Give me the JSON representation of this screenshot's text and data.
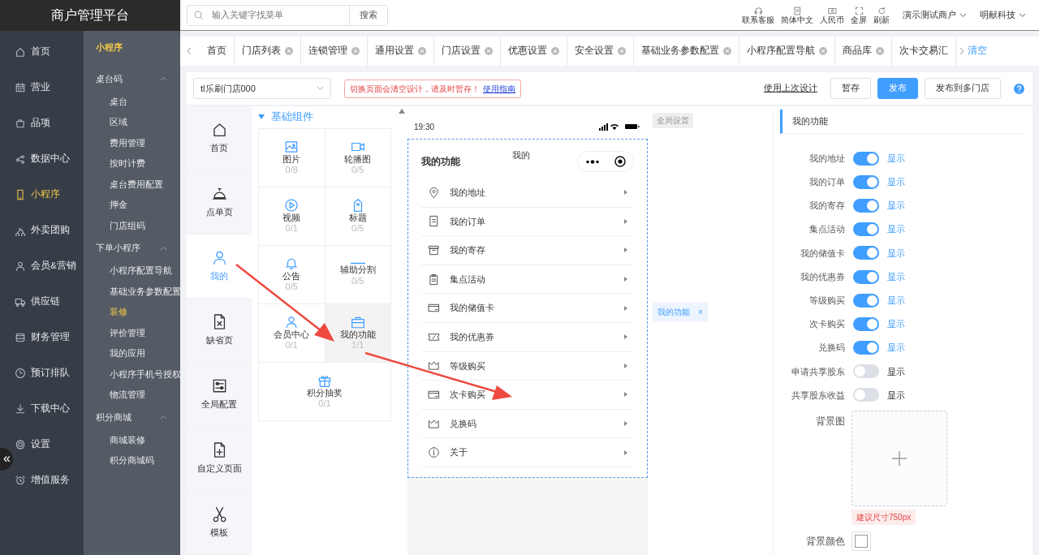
{
  "brand": {
    "title": "商户管理平台"
  },
  "search": {
    "placeholder": "输入关键字找菜单",
    "button": "搜索"
  },
  "header_tools": [
    {
      "label": "联系客服",
      "kind": "headset"
    },
    {
      "label": "简体中文",
      "kind": "doc"
    },
    {
      "label": "人民币",
      "kind": "money"
    },
    {
      "label": "全屏",
      "kind": "fullscreen"
    },
    {
      "label": "刷新",
      "kind": "refresh"
    }
  ],
  "accounts": [
    "演示测试商户",
    "明献科技"
  ],
  "nav": [
    {
      "label": "首页",
      "kind": "home",
      "selected": false
    },
    {
      "label": "营业",
      "kind": "calendar",
      "selected": false
    },
    {
      "label": "品项",
      "kind": "bag",
      "selected": false
    },
    {
      "label": "数据中心",
      "kind": "share",
      "selected": false
    },
    {
      "label": "小程序",
      "kind": "mobile",
      "selected": true
    },
    {
      "label": "外卖团购",
      "kind": "bike",
      "selected": false
    },
    {
      "label": "会员&营销",
      "kind": "user",
      "selected": false
    },
    {
      "label": "供应链",
      "kind": "truck",
      "selected": false
    },
    {
      "label": "财务管理",
      "kind": "database",
      "selected": false
    },
    {
      "label": "预订排队",
      "kind": "clock",
      "selected": false
    },
    {
      "label": "下载中心",
      "kind": "download",
      "selected": false
    },
    {
      "label": "设置",
      "kind": "gear",
      "selected": false
    },
    {
      "label": "增值服务",
      "kind": "alarm",
      "selected": false
    }
  ],
  "collapse_button": "«",
  "subnav": {
    "title": "小程序",
    "groups": [
      {
        "label": "桌台码",
        "expanded": true,
        "items": [
          {
            "label": "桌台",
            "selected": false
          },
          {
            "label": "区域",
            "selected": false
          },
          {
            "label": "费用管理",
            "selected": false
          },
          {
            "label": "按时计费",
            "selected": false
          },
          {
            "label": "桌台费用配置",
            "selected": false
          },
          {
            "label": "押金",
            "selected": false
          },
          {
            "label": "门店组码",
            "selected": false
          }
        ]
      },
      {
        "label": "下单小程序",
        "expanded": true,
        "items": [
          {
            "label": "小程序配置导航",
            "selected": false
          },
          {
            "label": "基础业务参数配置",
            "selected": false
          },
          {
            "label": "装修",
            "selected": true
          },
          {
            "label": "评价管理",
            "selected": false
          },
          {
            "label": "我的应用",
            "selected": false
          },
          {
            "label": "小程序手机号授权",
            "selected": false
          },
          {
            "label": "物流管理",
            "selected": false
          }
        ]
      },
      {
        "label": "积分商城",
        "expanded": true,
        "items": [
          {
            "label": "商城装修",
            "selected": false
          },
          {
            "label": "积分商城码",
            "selected": false
          }
        ]
      }
    ]
  },
  "tabs": [
    {
      "label": "首页",
      "closable": false
    },
    {
      "label": "门店列表",
      "closable": true
    },
    {
      "label": "连锁管理",
      "closable": true
    },
    {
      "label": "通用设置",
      "closable": true
    },
    {
      "label": "门店设置",
      "closable": true
    },
    {
      "label": "优惠设置",
      "closable": true
    },
    {
      "label": "安全设置",
      "closable": true
    },
    {
      "label": "基础业务参数配置",
      "closable": true
    },
    {
      "label": "小程序配置导航",
      "closable": true
    },
    {
      "label": "商品库",
      "closable": true
    },
    {
      "label": "次卡交易汇",
      "closable": false
    }
  ],
  "tabs_clear": "清空",
  "store_select": {
    "value": "tl乐刷门店000"
  },
  "notice": {
    "text": "切换页面会清空设计，请及时暂存！",
    "link": "使用指南"
  },
  "actions": {
    "link": "使用上次设计",
    "buttons": [
      {
        "label": "暂存",
        "primary": false
      },
      {
        "label": "发布",
        "primary": true
      },
      {
        "label": "发布到多门店",
        "primary": false
      }
    ]
  },
  "page_types": [
    {
      "label": "首页",
      "kind": "home",
      "selected": false
    },
    {
      "label": "点单页",
      "kind": "cloche",
      "selected": false
    },
    {
      "label": "我的",
      "kind": "user",
      "selected": true
    },
    {
      "label": "缺省页",
      "kind": "filex",
      "selected": false
    },
    {
      "label": "全局配置",
      "kind": "sliders",
      "selected": false
    },
    {
      "label": "自定义页面",
      "kind": "fileplus",
      "selected": false
    },
    {
      "label": "模板",
      "kind": "scissors",
      "selected": false
    }
  ],
  "components": {
    "title": "基础组件",
    "items": [
      {
        "label": "图片",
        "count": "0/8",
        "kind": "image",
        "selected": false
      },
      {
        "label": "轮播图",
        "count": "0/5",
        "kind": "video",
        "selected": false
      },
      {
        "label": "视频",
        "count": "0/1",
        "kind": "play",
        "selected": false
      },
      {
        "label": "标题",
        "count": "0/5",
        "kind": "tag",
        "selected": false
      },
      {
        "label": "公告",
        "count": "0/5",
        "kind": "bell",
        "selected": false
      },
      {
        "label": "辅助分割",
        "count": "0/5",
        "kind": "line",
        "selected": false
      },
      {
        "label": "会员中心",
        "count": "0/1",
        "kind": "user",
        "selected": false
      },
      {
        "label": "我的功能",
        "count": "1/1",
        "kind": "briefcase",
        "selected": true
      },
      {
        "label": "积分抽奖",
        "count": "0/1",
        "kind": "gift",
        "selected": false
      }
    ]
  },
  "phone": {
    "time": "19:30",
    "page_title": "我的",
    "section_title": "我的功能",
    "rows": [
      {
        "label": "我的地址",
        "kind": "pin"
      },
      {
        "label": "我的订单",
        "kind": "doc"
      },
      {
        "label": "我的寄存",
        "kind": "box"
      },
      {
        "label": "集点活动",
        "kind": "clipboard"
      },
      {
        "label": "我的储值卡",
        "kind": "card"
      },
      {
        "label": "我的优惠券",
        "kind": "ticket"
      },
      {
        "label": "等级购买",
        "kind": "crown"
      },
      {
        "label": "次卡购买",
        "kind": "card"
      },
      {
        "label": "兑换码",
        "kind": "crown"
      },
      {
        "label": "关于",
        "kind": "info"
      }
    ]
  },
  "global_settings": "全局设置",
  "component_tag": {
    "label": "我的功能",
    "close": "×"
  },
  "settings": {
    "title": "我的功能",
    "toggles": [
      {
        "label": "我的地址",
        "on": true,
        "state_text": "显示"
      },
      {
        "label": "我的订单",
        "on": true,
        "state_text": "显示"
      },
      {
        "label": "我的寄存",
        "on": true,
        "state_text": "显示"
      },
      {
        "label": "集点活动",
        "on": true,
        "state_text": "显示"
      },
      {
        "label": "我的储值卡",
        "on": true,
        "state_text": "显示"
      },
      {
        "label": "我的优惠券",
        "on": true,
        "state_text": "显示"
      },
      {
        "label": "等级购买",
        "on": true,
        "state_text": "显示"
      },
      {
        "label": "次卡购买",
        "on": true,
        "state_text": "显示"
      },
      {
        "label": "兑换码",
        "on": true,
        "state_text": "显示"
      },
      {
        "label": "申请共享股东",
        "on": false,
        "state_text": "显示"
      },
      {
        "label": "共享股东收益",
        "on": false,
        "state_text": "显示"
      }
    ],
    "background_image": {
      "label": "背景图",
      "hint": "建议尺寸750px"
    },
    "background_color": {
      "label": "背景颜色"
    }
  }
}
